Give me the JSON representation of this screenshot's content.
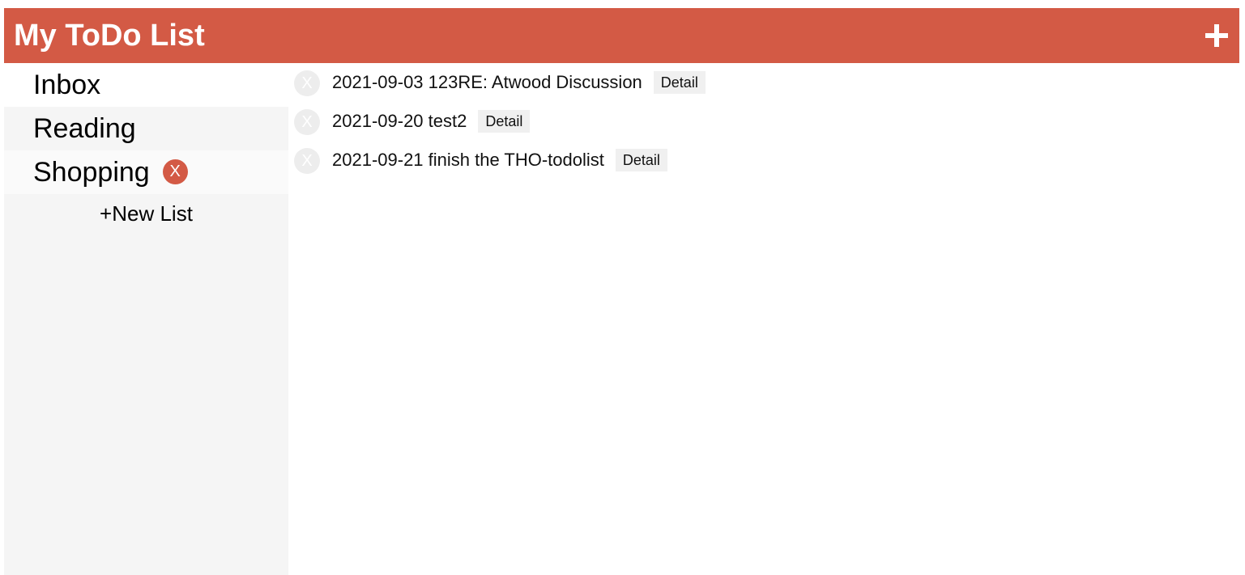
{
  "header": {
    "title": "My ToDo List",
    "add_label": "+"
  },
  "sidebar": {
    "lists": [
      {
        "label": "Inbox"
      },
      {
        "label": "Reading"
      },
      {
        "label": "Shopping",
        "delete_label": "X"
      }
    ],
    "new_list_label": "+New List"
  },
  "todos": [
    {
      "text": "2021-09-03 123RE: Atwood Discussion",
      "done_label": "X",
      "detail_label": "Detail"
    },
    {
      "text": "2021-09-20 test2",
      "done_label": "X",
      "detail_label": "Detail"
    },
    {
      "text": "2021-09-21 finish the THO-todolist",
      "done_label": "X",
      "detail_label": "Detail"
    }
  ],
  "colors": {
    "accent": "#d35a45",
    "sidebar_bg": "#f5f5f5",
    "button_bg": "#f0f0f0",
    "done_circle": "#ededed"
  },
  "icons": {
    "add": "plus-icon",
    "delete_list": "close-icon",
    "complete": "close-icon"
  }
}
